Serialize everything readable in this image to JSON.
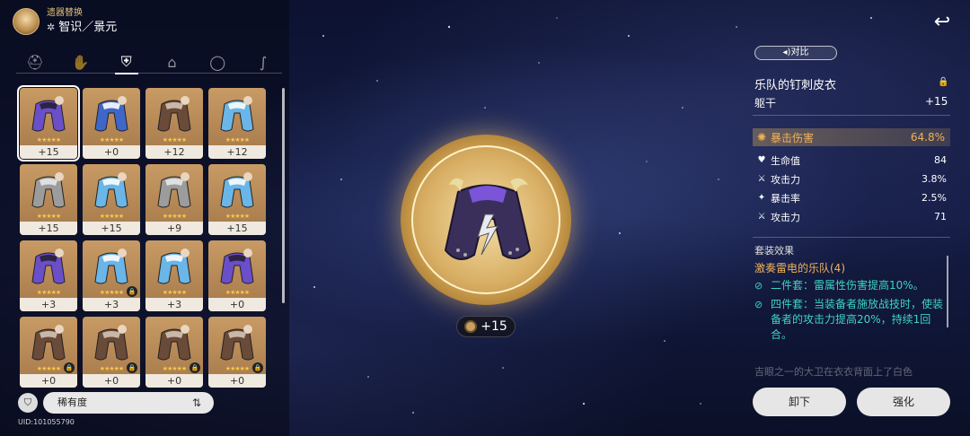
{
  "header": {
    "title": "遗器替换",
    "path_icon": "path-erudition-icon",
    "subtitle": "智识／景元"
  },
  "tabs": [
    {
      "name": "head",
      "icon": "helmet-icon",
      "active": false
    },
    {
      "name": "hands",
      "icon": "gauntlet-icon",
      "active": false
    },
    {
      "name": "body",
      "icon": "armor-icon",
      "active": true
    },
    {
      "name": "feet",
      "icon": "boots-icon",
      "active": false
    },
    {
      "name": "sphere",
      "icon": "ring-icon",
      "active": false
    },
    {
      "name": "rope",
      "icon": "rope-icon",
      "active": false
    }
  ],
  "items": [
    {
      "level": "+15",
      "locked": false,
      "selected": true,
      "variant": "purple",
      "stars": "★★★★★"
    },
    {
      "level": "+0",
      "locked": false,
      "selected": false,
      "variant": "blue",
      "stars": "★★★★★"
    },
    {
      "level": "+12",
      "locked": false,
      "selected": false,
      "variant": "brown",
      "stars": "★★★★★"
    },
    {
      "level": "+12",
      "locked": false,
      "selected": false,
      "variant": "cyan",
      "stars": "★★★★★"
    },
    {
      "level": "+15",
      "locked": false,
      "selected": false,
      "variant": "grey",
      "stars": "★★★★★"
    },
    {
      "level": "+15",
      "locked": false,
      "selected": false,
      "variant": "cyan",
      "stars": "★★★★★"
    },
    {
      "level": "+9",
      "locked": false,
      "selected": false,
      "variant": "grey",
      "stars": "★★★★★"
    },
    {
      "level": "+15",
      "locked": false,
      "selected": false,
      "variant": "cyan",
      "stars": "★★★★★"
    },
    {
      "level": "+3",
      "locked": false,
      "selected": false,
      "variant": "purple",
      "stars": "★★★★★"
    },
    {
      "level": "+3",
      "locked": true,
      "selected": false,
      "variant": "cyan",
      "stars": "★★★★★"
    },
    {
      "level": "+3",
      "locked": false,
      "selected": false,
      "variant": "cyan",
      "stars": "★★★★★"
    },
    {
      "level": "+0",
      "locked": false,
      "selected": false,
      "variant": "purple",
      "stars": "★★★★★"
    },
    {
      "level": "+0",
      "locked": true,
      "selected": false,
      "variant": "brown",
      "stars": "★★★★★"
    },
    {
      "level": "+0",
      "locked": true,
      "selected": false,
      "variant": "brown",
      "stars": "★★★★★"
    },
    {
      "level": "+0",
      "locked": true,
      "selected": false,
      "variant": "brown",
      "stars": "★★★★★"
    },
    {
      "level": "+0",
      "locked": true,
      "selected": false,
      "variant": "brown",
      "stars": "★★★★★"
    }
  ],
  "lock_glyph": "🔒",
  "sort": {
    "label": "稀有度",
    "icon": "sort-order-icon",
    "filter_icon": "filter-icon"
  },
  "uid": "UID:101055790",
  "center": {
    "level": "+15",
    "icon": "relic-level-coin-icon"
  },
  "compare": {
    "label": "◂)对比"
  },
  "detail": {
    "name": "乐队的钉刺皮衣",
    "slot": "躯干",
    "level": "+15",
    "main_stat": {
      "label": "暴击伤害",
      "value": "64.8%",
      "icon": "crit-dmg-icon"
    },
    "sub_stats": [
      {
        "label": "生命值",
        "value": "84",
        "icon": "hp-icon"
      },
      {
        "label": "攻击力",
        "value": "3.8%",
        "icon": "atk-icon"
      },
      {
        "label": "暴击率",
        "value": "2.5%",
        "icon": "crit-rate-icon"
      },
      {
        "label": "攻击力",
        "value": "71",
        "icon": "atk-icon"
      }
    ],
    "set_title": "套装效果",
    "set_name": "激奏雷电的乐队(4)",
    "effect_2": "二件套：雷属性伤害提高10%。",
    "effect_4": "四件套：当装备者施放战技时，使装备者的攻击力提高20%，持续1回合。",
    "desc": "吉眼之一的大卫在衣衣背面上了白色"
  },
  "buttons": {
    "unequip": "卸下",
    "upgrade": "强化"
  },
  "colors": {
    "accent_gold": "#f0b25a",
    "effect_teal": "#3fd3c4",
    "card_bg": "#b98a56"
  }
}
